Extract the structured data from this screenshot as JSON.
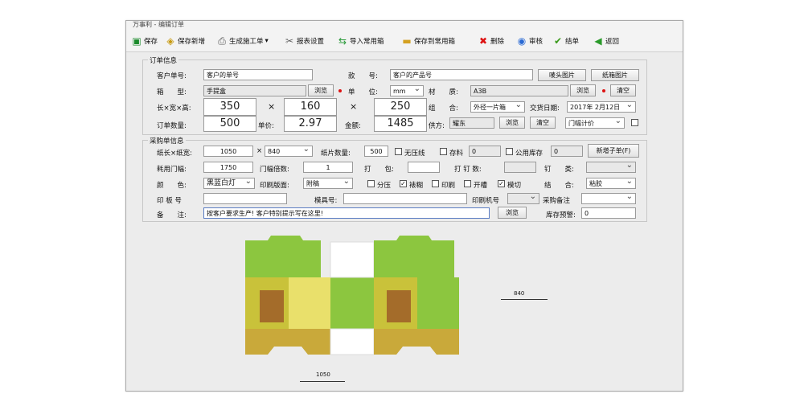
{
  "window": {
    "title": "万事利 - 编辑订单"
  },
  "toolbar": {
    "save": "保存",
    "save_new": "保存新增",
    "gen_ticket": "生成施工单",
    "report_settings": "报表设置",
    "import_box": "导入常用箱",
    "save_box": "保存到常用箱",
    "delete": "删除",
    "audit": "审核",
    "finish": "结单",
    "back": "返回"
  },
  "order": {
    "group_title": "订单信息",
    "cust_no_label": "客户单号:",
    "cust_no_value": "客户的单号",
    "style_no_label": "款　　号:",
    "style_no_value": "客户的产品号",
    "btn_mark_img": "唛头图片",
    "btn_box_img": "纸箱图片",
    "box_type_label": "箱　　型:",
    "box_type_value": "手提盒",
    "btn_browse": "浏览",
    "unit_label": "单　　位:",
    "unit_value": "mm",
    "material_label": "材　　质:",
    "material_value": "A3B",
    "btn_clear": "清空",
    "dims_label": "长×宽×高:",
    "length": "350",
    "width": "160",
    "height": "250",
    "times": "×",
    "combine_label": "组　　合:",
    "combine_value": "外径一片箱",
    "delivery_label": "交货日期:",
    "delivery_value": "2017年 2月12日",
    "qty_label": "订单数量:",
    "qty_value": "500",
    "price_label": "单价:",
    "price_value": "2.97",
    "amount_label": "金额:",
    "amount_value": "1485",
    "supplier_label": "供方:",
    "supplier_value": "耀东",
    "pricing_value": "门幅计价"
  },
  "purchase": {
    "group_title": "采购单信息",
    "size_label": "纸长×纸宽:",
    "paper_len": "1050",
    "paper_wid": "840",
    "sheet_qty_label": "纸片数量:",
    "sheet_qty_value": "500",
    "no_crease": "无压线",
    "stock": "存料",
    "stock_value": "0",
    "public_stock": "公用库存",
    "public_value": "0",
    "btn_new_sub": "新增子单(F)",
    "door_width_label": "耗用门幅:",
    "door_width_value": "1750",
    "door_count_label": "门幅倍数:",
    "door_count_value": "1",
    "pack_label": "打　　包:",
    "nail_label": "打 钉 数:",
    "nail_type_label": "钉　　类:",
    "color_label": "颜　　色:",
    "color_value": "黑蓝白灯",
    "print_side_label": "印刷版面:",
    "print_side_value": "附稿",
    "split": "分压",
    "laminate": "裱糊",
    "print": "印刷",
    "slot": "开槽",
    "die_cut": "模切",
    "bond_label": "结　　合:",
    "bond_value": "粘胶",
    "plate_label": "印 板 号",
    "mold_label": "模具号:",
    "printer_label": "印刷机号",
    "purchase_note_label": "采购备注",
    "remark_label": "备　　注:",
    "remark_value": "按客户要求生产! 客户特别提示写在这里!",
    "warning_label": "库存预警:",
    "warning_value": "0"
  },
  "preview": {
    "dim_width": "840",
    "dim_length": "1050"
  }
}
